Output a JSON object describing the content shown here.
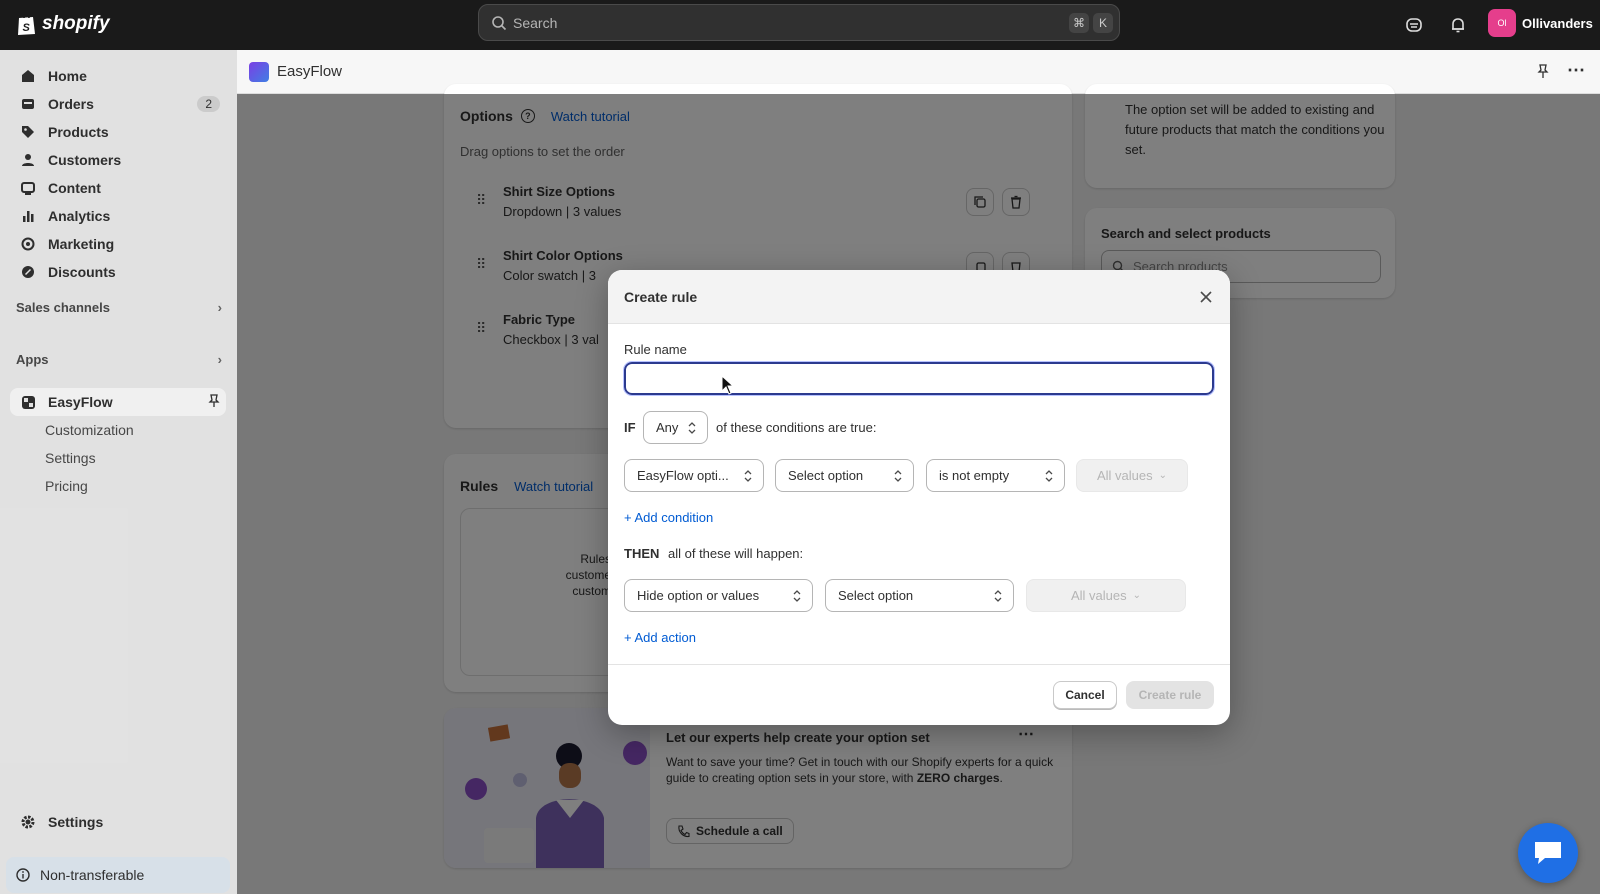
{
  "topbar": {
    "logo_text": "shopify",
    "search_placeholder": "Search",
    "kbd_cmd": "⌘",
    "kbd_key": "K",
    "store_initials": "Ol",
    "store_name": "Ollivanders"
  },
  "sidebar": {
    "items": [
      {
        "label": "Home",
        "icon": "home-icon"
      },
      {
        "label": "Orders",
        "icon": "orders-icon",
        "badge": "2"
      },
      {
        "label": "Products",
        "icon": "tag-icon"
      },
      {
        "label": "Customers",
        "icon": "person-icon"
      },
      {
        "label": "Content",
        "icon": "content-icon"
      },
      {
        "label": "Analytics",
        "icon": "analytics-icon"
      },
      {
        "label": "Marketing",
        "icon": "target-icon"
      },
      {
        "label": "Discounts",
        "icon": "discount-icon"
      }
    ],
    "sales_channels": "Sales channels",
    "apps": "Apps",
    "app_name": "EasyFlow",
    "sub_items": [
      "Customization",
      "Settings",
      "Pricing"
    ],
    "settings": "Settings",
    "non_transferable": "Non-transferable"
  },
  "app_header": {
    "title": "EasyFlow"
  },
  "options_card": {
    "title": "Options",
    "watch_tutorial": "Watch tutorial",
    "hint": "Drag options to set the order",
    "options": [
      {
        "name": "Shirt Size Options",
        "meta": "Dropdown | 3 values"
      },
      {
        "name": "Shirt Color Options",
        "meta": "Color swatch | 3"
      },
      {
        "name": "Fabric Type",
        "meta": "Checkbox | 3 val"
      }
    ]
  },
  "rules_card": {
    "title": "Rules",
    "watch_tutorial": "Watch tutorial",
    "empty_lines": [
      "Rules",
      "custome",
      "custom"
    ]
  },
  "experts_card": {
    "title": "Let our experts help create your option set",
    "body_prefix": "Want to save your time? Get in touch with our Shopify experts for a quick guide to creating option sets in your store, with ",
    "body_bold": "ZERO charges",
    "body_suffix": ".",
    "button": "Schedule a call"
  },
  "right_panel": {
    "info_text": "The option set will be added to existing and future products that match the conditions you set.",
    "search_title": "Search and select products",
    "search_placeholder": "Search products"
  },
  "modal": {
    "title": "Create rule",
    "rule_name_label": "Rule name",
    "rule_name_value": "",
    "if_label": "IF",
    "any_value": "Any",
    "conditions_text": "of these conditions are true:",
    "condition": {
      "field": "EasyFlow opti...",
      "option": "Select option",
      "operator": "is not empty",
      "values": "All values"
    },
    "add_condition": "+ Add condition",
    "then_label": "THEN",
    "then_text": "all of these will happen:",
    "action": {
      "type": "Hide option or values",
      "option": "Select option",
      "values": "All values"
    },
    "add_action": "+ Add action",
    "cancel": "Cancel",
    "create": "Create rule"
  }
}
